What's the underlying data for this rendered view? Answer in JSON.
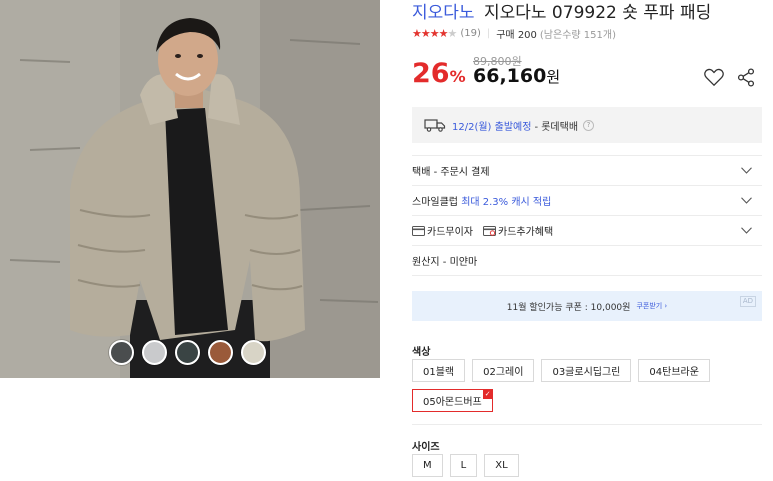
{
  "product": {
    "brand": "지오다노",
    "name": "지오다노 079922 숏 푸파 패딩",
    "rating": {
      "stars_filled": "★★★★",
      "stars_empty": "★",
      "review_count": "(19)",
      "purchase_count": "구매 200",
      "remaining": "(남은수량 151개)"
    },
    "price": {
      "original": "89,800원",
      "discount_number": "26",
      "discount_symbol": "%",
      "sale_number": "66,160",
      "sale_unit": "원"
    }
  },
  "icons": {
    "wishlist": "heart-icon",
    "share": "share-icon",
    "shipping": "truck-icon",
    "expand": "chevron-down-icon",
    "card": "card-icon"
  },
  "shipping": {
    "date": "12/2(월) 출발예정",
    "carrier": "- 롯데택배",
    "help": "?"
  },
  "options": {
    "delivery": "택배 - 주문시 결제",
    "smile_club_prefix": "스마일클럽 ",
    "smile_club_value": "최대 2.3% 캐시 적립",
    "card_interest_free": "카드무이자",
    "card_extra_benefit": "카드추가혜택",
    "origin": "원산지 - 미얀마"
  },
  "coupon": {
    "text": "11월 할인가능 쿠폰 : 10,000원",
    "link": "쿠폰받기 ›",
    "ad_label": "AD"
  },
  "color_section": {
    "label": "색상",
    "options": [
      "01블랙",
      "02그레이",
      "03글로시딥그린",
      "04탄브라운",
      "05아몬드버프"
    ],
    "selected": "05아몬드버프",
    "check": "✓"
  },
  "size_section": {
    "label": "사이즈",
    "options": [
      "M",
      "L",
      "XL"
    ]
  },
  "swatch_colors": [
    "#4a4d4e",
    "#c9cacc",
    "#3a4444",
    "#9a5a3a",
    "#d8d4c6"
  ],
  "colors": {
    "accent_blue": "#3b5bdb",
    "discount_red": "#e32b2b",
    "jacket": "#b5ad9c"
  }
}
